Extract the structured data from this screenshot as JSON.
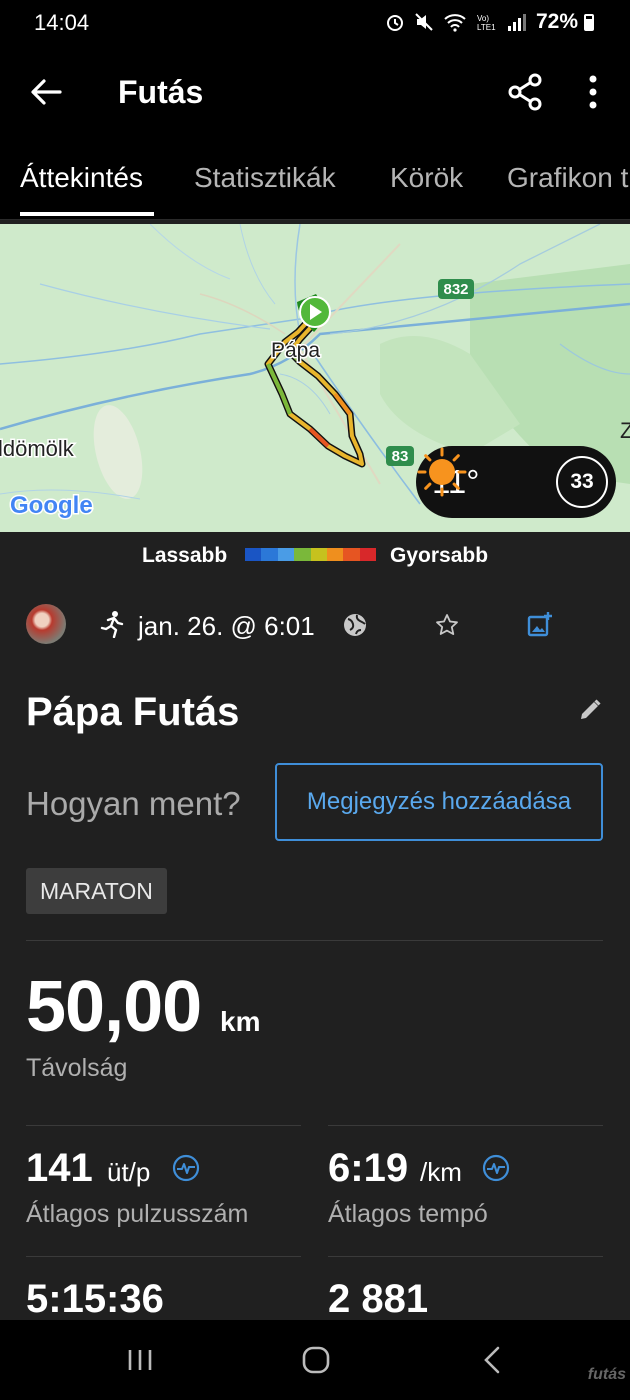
{
  "status_bar": {
    "time": "14:04",
    "battery": "72%"
  },
  "header": {
    "title": "Futás"
  },
  "tabs": [
    {
      "label": "Áttekintés"
    },
    {
      "label": "Statisztikák"
    },
    {
      "label": "Körök"
    },
    {
      "label": "Grafikon t"
    }
  ],
  "map": {
    "labels": {
      "town": "Pápa",
      "west_town": "ldömölk",
      "road_832": "832",
      "road_83": "83",
      "provider": "Google",
      "edge_letter": "Z"
    },
    "weather": {
      "temperature": "11°",
      "badge": "33"
    }
  },
  "legend": {
    "slow": "Lassabb",
    "fast": "Gyorsabb",
    "colors": [
      "#1a55c4",
      "#2b78d8",
      "#4a9ce6",
      "#7ab83a",
      "#c6c21e",
      "#ef8f1e",
      "#e65522",
      "#d8282a"
    ]
  },
  "meta": {
    "date": "jan. 26. @ 6:01"
  },
  "activity": {
    "title": "Pápa Futás",
    "question": "Hogyan ment?",
    "add_note": "Megjegyzés hozzáadása",
    "tag": "MARATON"
  },
  "distance": {
    "value": "50,00",
    "unit": "km",
    "label": "Távolság"
  },
  "stats": [
    {
      "value": "141",
      "unit": "üt/p",
      "label": "Átlagos pulzusszám"
    },
    {
      "value": "6:19",
      "unit": "/km",
      "label": "Átlagos tempó"
    },
    {
      "value": "5:15:36"
    },
    {
      "value": "2 881"
    }
  ],
  "colors": {
    "accent": "#3f8ed8",
    "background": "#202020",
    "header": "#000000"
  },
  "watermark": "futás"
}
